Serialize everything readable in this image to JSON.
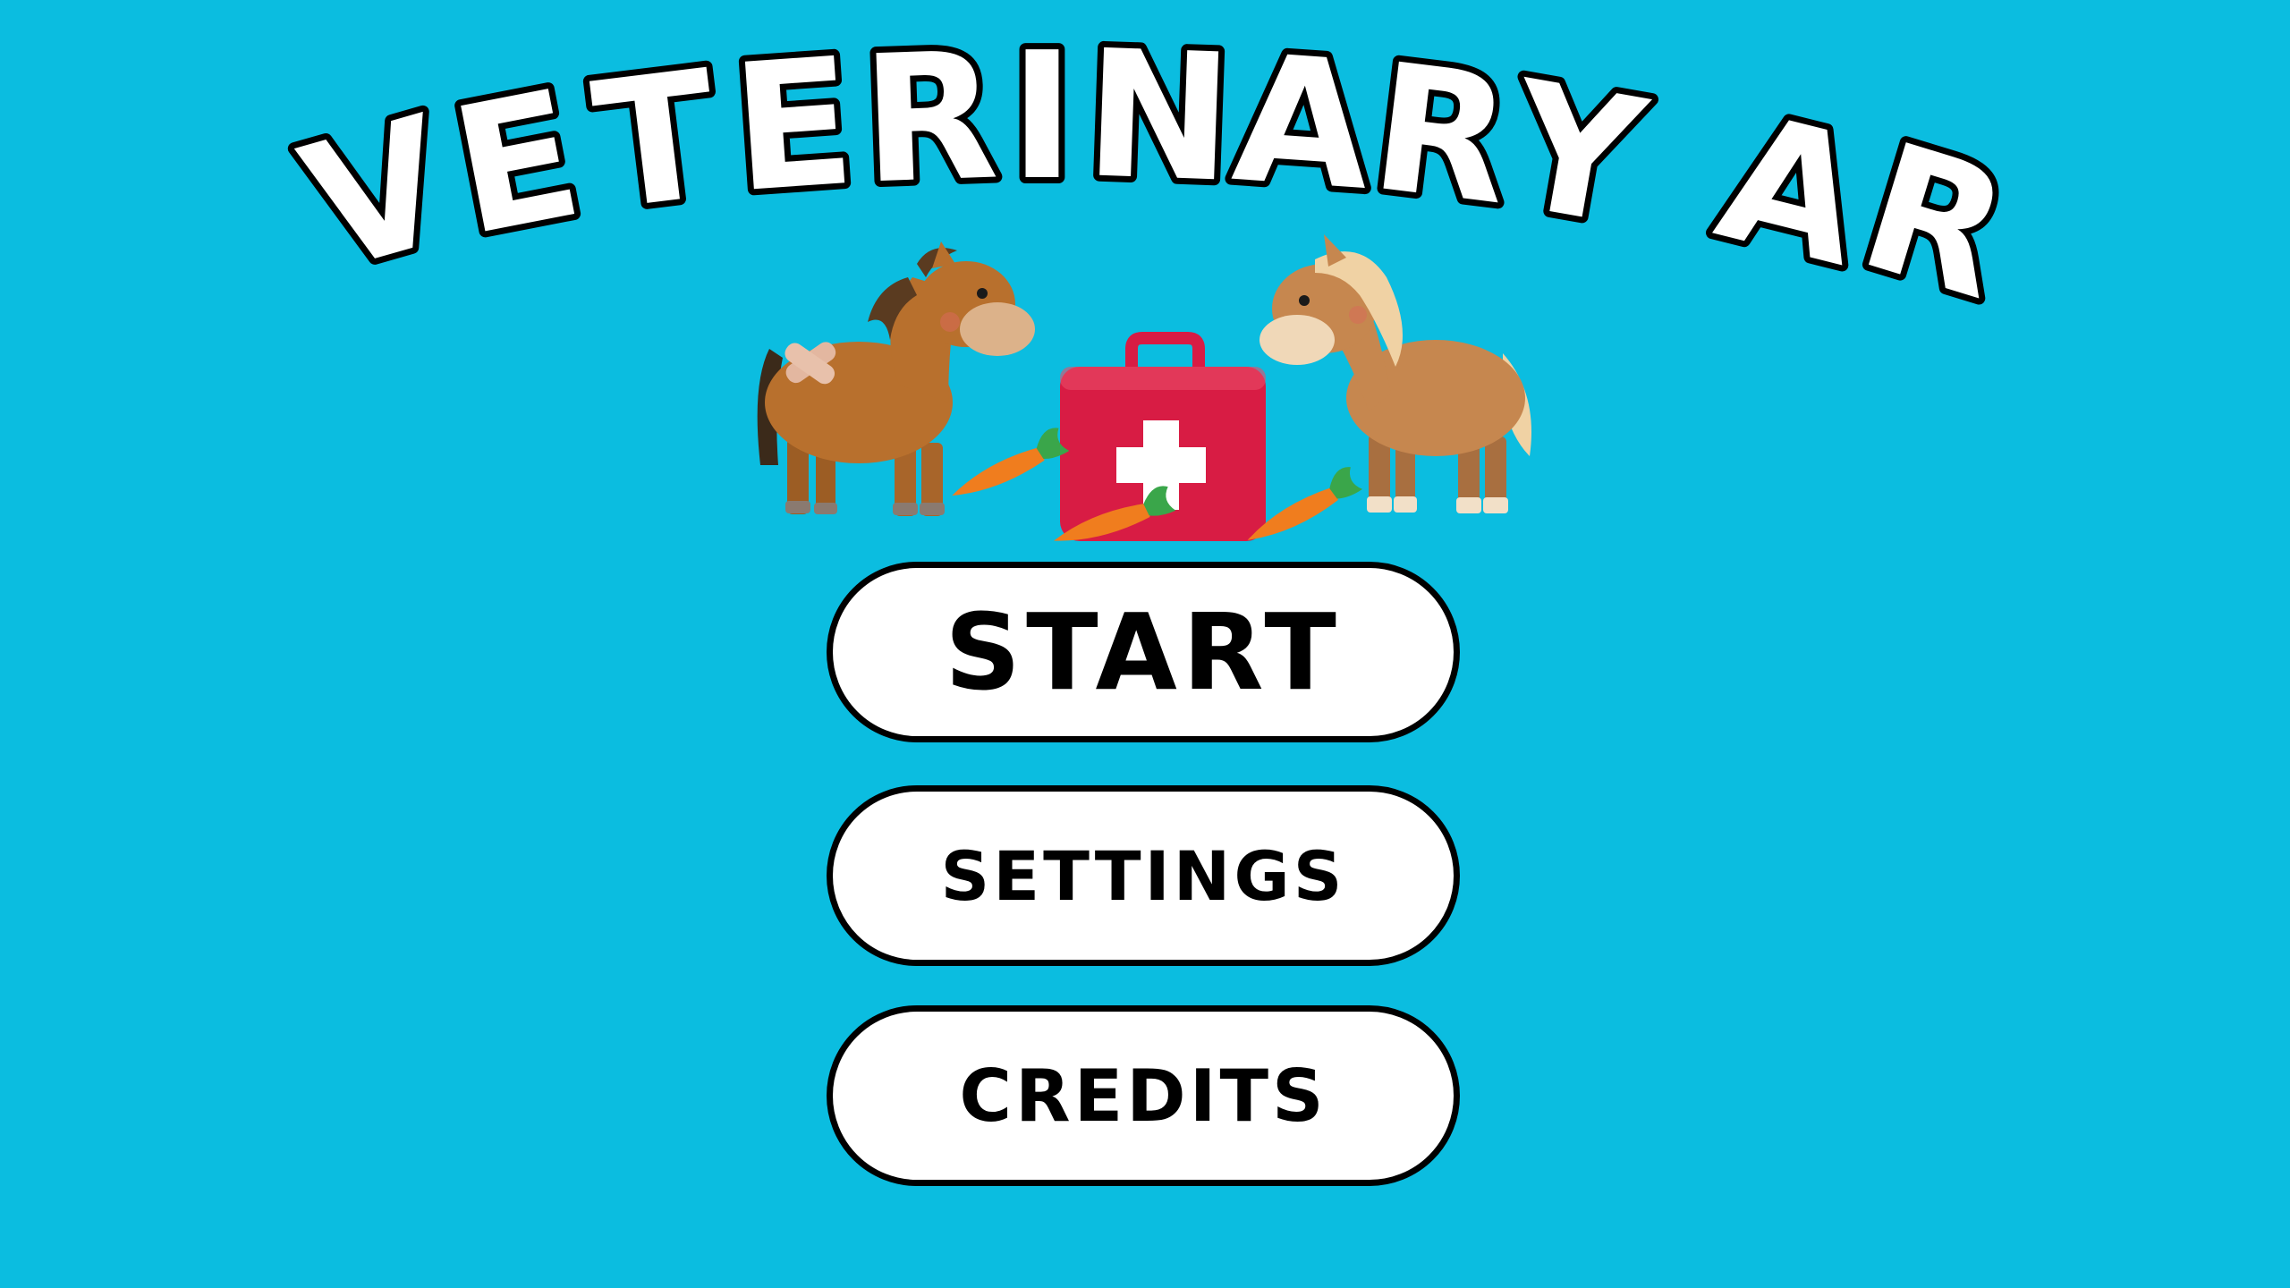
{
  "title": {
    "text": "VETERINARY AR",
    "letters": [
      "V",
      "E",
      "T",
      "E",
      "R",
      "I",
      "N",
      "A",
      "R",
      "Y",
      "A",
      "R"
    ]
  },
  "illustration": {
    "left_horse": "injured-horse",
    "right_horse": "light-mane-horse",
    "kit": "first-aid-kit-icon",
    "carrots": [
      "carrot-icon",
      "carrot-icon",
      "carrot-icon"
    ]
  },
  "menu": {
    "start_label": "START",
    "settings_label": "SETTINGS",
    "credits_label": "CREDITS"
  },
  "colors": {
    "background": "#0bbde0",
    "button_fill": "#ffffff",
    "button_border": "#000000",
    "title_fill": "#ffffff",
    "title_stroke": "#000000",
    "kit_red": "#d81c44",
    "carrot_orange": "#f07d1e",
    "horse_brown": "#b8702d",
    "horse_light": "#c6874f"
  }
}
